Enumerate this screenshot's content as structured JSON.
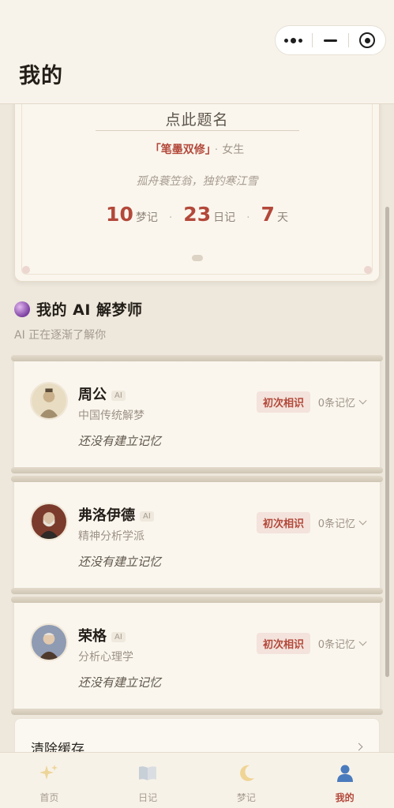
{
  "header": {
    "title": "我的",
    "capsule": {
      "more_icon": "more-dots-icon",
      "minimize_icon": "minimize-icon",
      "close_icon": "target-icon"
    }
  },
  "profile": {
    "name_prompt": "点此题名",
    "pen_name": "「笔墨双修」",
    "separator": "·",
    "gender": "女生",
    "quote": "孤舟蓑笠翁，独钓寒江雪",
    "stats": [
      {
        "value": "10",
        "unit": "梦记"
      },
      {
        "value": "23",
        "unit": "日记"
      },
      {
        "value": "7",
        "unit": "天"
      }
    ],
    "stat_separator": "·"
  },
  "ai_section": {
    "title": "我的 AI 解梦师",
    "subtitle": "AI 正在逐渐了解你",
    "dreamers": [
      {
        "name": "周公",
        "badge": "AI",
        "school": "中国传统解梦",
        "tag": "初次相识",
        "memory": "0条记忆",
        "note": "还没有建立记忆"
      },
      {
        "name": "弗洛伊德",
        "badge": "AI",
        "school": "精神分析学派",
        "tag": "初次相识",
        "memory": "0条记忆",
        "note": "还没有建立记忆"
      },
      {
        "name": "荣格",
        "badge": "AI",
        "school": "分析心理学",
        "tag": "初次相识",
        "memory": "0条记忆",
        "note": "还没有建立记忆"
      }
    ]
  },
  "settings": {
    "clear_cache": "清除缓存"
  },
  "tabbar": {
    "tabs": [
      {
        "label": "首页",
        "icon": "sparkles-icon"
      },
      {
        "label": "日记",
        "icon": "open-book-icon"
      },
      {
        "label": "梦记",
        "icon": "crescent-moon-icon"
      },
      {
        "label": "我的",
        "icon": "user-icon"
      }
    ],
    "active": "我的"
  },
  "colors": {
    "accent": "#b3483a",
    "background": "#ede7dc",
    "card": "#faf6ee"
  }
}
